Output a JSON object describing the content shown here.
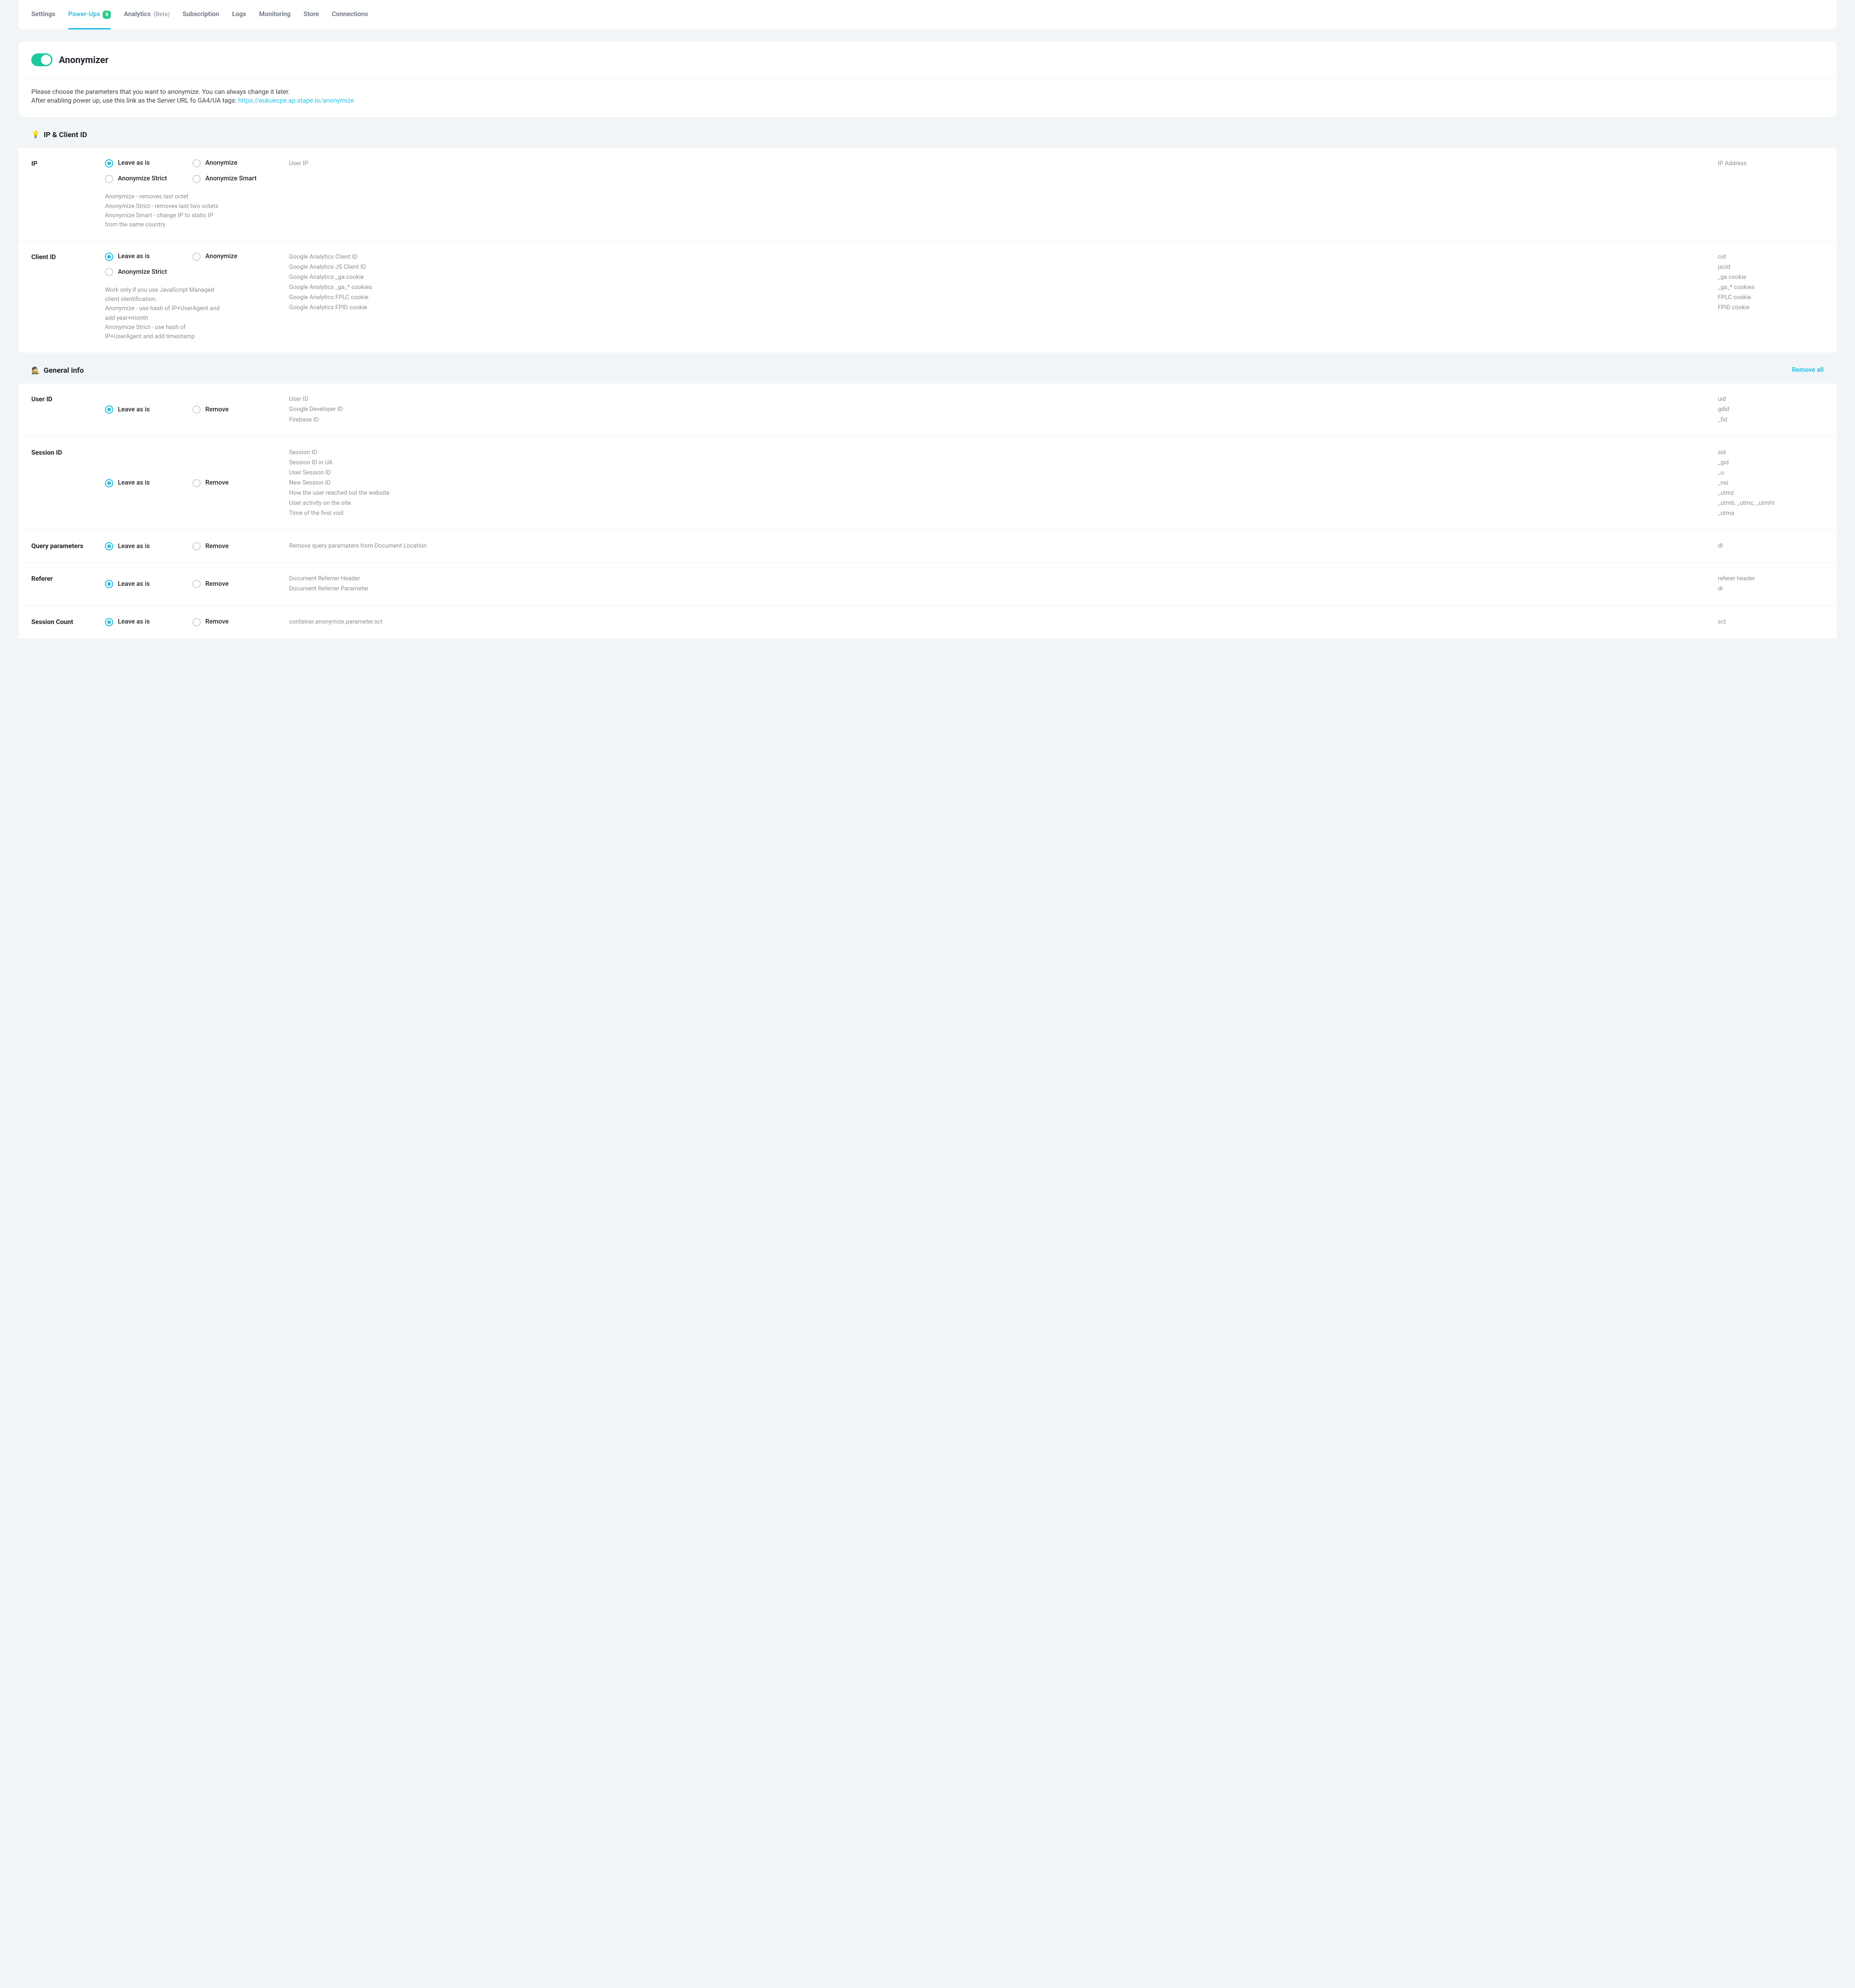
{
  "tabs": [
    {
      "label": "Settings",
      "active": false
    },
    {
      "label": "Power-Ups",
      "badge": "6",
      "active": true
    },
    {
      "label": "Analytics",
      "sub": "(Beta)",
      "active": false
    },
    {
      "label": "Subscription",
      "active": false
    },
    {
      "label": "Logs",
      "active": false
    },
    {
      "label": "Monitoring",
      "active": false
    },
    {
      "label": "Store",
      "active": false
    },
    {
      "label": "Connections",
      "active": false
    }
  ],
  "panel": {
    "title": "Anonymizer",
    "enabled": true,
    "info_line1": "Please choose the parameters that you want to anonymize. You can always change it later.",
    "info_line2_prefix": "After enabling power up, use this link as the Server URL fo GA4/UA tags: ",
    "info_link": "https://eukuecpe.ap.stape.io/anonymize"
  },
  "sections": [
    {
      "emoji": "💡",
      "title": "IP & Client ID",
      "action": null,
      "rows": [
        {
          "label": "IP",
          "options": [
            {
              "label": "Leave as is",
              "selected": true
            },
            {
              "label": "Anonymize",
              "selected": false
            },
            {
              "label": "Anonymize Strict",
              "selected": false
            },
            {
              "label": "Anonymize Smart",
              "selected": false
            }
          ],
          "help": "Anonymize - removes last octet\nAnonymize Strict - removes last two octets\nAnonymize Smart - change IP to static IP from the same country",
          "descs": [
            "User IP"
          ],
          "keys": [
            "IP Address"
          ]
        },
        {
          "label": "Client ID",
          "options": [
            {
              "label": "Leave as is",
              "selected": true
            },
            {
              "label": "Anonymize",
              "selected": false
            },
            {
              "label": "Anonymize Strict",
              "selected": false,
              "full": true
            }
          ],
          "help": "Work only if you use JavaScript Managed client identification.\nAnonymize - use hash of IP+UserAgent and add year+month\nAnonymize Strict - use hash of IP+UserAgent and add timestamp",
          "descs": [
            "Google Analytics Client ID",
            "Google Analytics JS Client ID",
            "Google Analytics _ga cookie",
            "Google Analytics _ga_* cookies",
            "Google Analytics FPLC cookie",
            "Google Analytics FPID cookie"
          ],
          "keys": [
            "cid",
            "jscid",
            "_ga cookie",
            "_ga_* cookies",
            "FPLC cookie",
            "FPID cookie"
          ]
        }
      ]
    },
    {
      "emoji": "🕵️",
      "title": "General info",
      "action": "Remove all",
      "rows": [
        {
          "label": "User ID",
          "options": [
            {
              "label": "Leave as is",
              "selected": true
            },
            {
              "label": "Remove",
              "selected": false
            }
          ],
          "descs": [
            "User ID",
            "Google Developer ID",
            "Firebase ID"
          ],
          "keys": [
            "uid",
            "gdid",
            "_fid"
          ]
        },
        {
          "label": "Session ID",
          "options": [
            {
              "label": "Leave as is",
              "selected": true
            },
            {
              "label": "Remove",
              "selected": false
            }
          ],
          "descs": [
            "Session ID",
            "Session ID in UA",
            "User Session ID",
            "New Session ID",
            "How the user reached out the website",
            "User activity on the site",
            "Time of the first visit"
          ],
          "keys": [
            "sid",
            "_gid",
            "_u",
            "_nsi",
            "_utmz",
            "_utmb, _utmc, _utmht",
            "_utma"
          ]
        },
        {
          "label": "Query parameters",
          "options": [
            {
              "label": "Leave as is",
              "selected": true
            },
            {
              "label": "Remove",
              "selected": false
            }
          ],
          "descs": [
            "Remove query paramaters from Document Location"
          ],
          "keys": [
            "dl"
          ]
        },
        {
          "label": "Referer",
          "options": [
            {
              "label": "Leave as is",
              "selected": true
            },
            {
              "label": "Remove",
              "selected": false
            }
          ],
          "descs": [
            "Document Referrer Header",
            "Document Referrer Parameter"
          ],
          "keys": [
            "referer header",
            "dr"
          ]
        },
        {
          "label": "Session Count",
          "options": [
            {
              "label": "Leave as is",
              "selected": true
            },
            {
              "label": "Remove",
              "selected": false
            }
          ],
          "descs": [
            "container.anonymize.parameter.sct"
          ],
          "keys": [
            "sct"
          ]
        }
      ]
    }
  ]
}
